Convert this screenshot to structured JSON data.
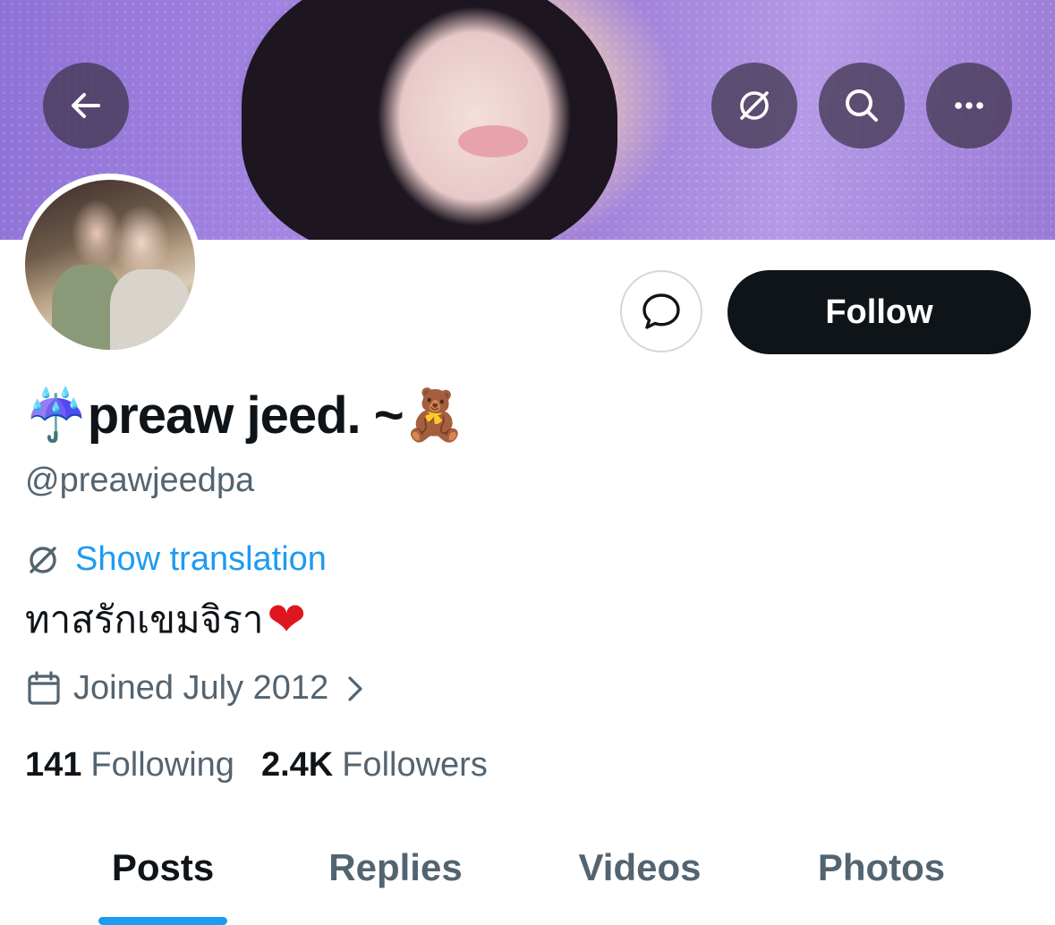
{
  "header": {
    "back_icon": "arrow-left-icon",
    "actions": [
      "translate-icon",
      "search-icon",
      "more-icon"
    ]
  },
  "profile": {
    "display_name": "preaw jeed. ~",
    "name_prefix_emoji": "☔",
    "name_suffix_emoji": "🧸",
    "handle": "@preawjeedpa",
    "show_translation_label": "Show translation",
    "bio": "ทาสรักเขมจิรา",
    "bio_emoji": "❤",
    "joined": "Joined July 2012",
    "following_count": "141",
    "following_label": "Following",
    "followers_count": "2.4K",
    "followers_label": "Followers"
  },
  "actions": {
    "follow_label": "Follow"
  },
  "tabs": [
    {
      "label": "Posts",
      "active": true
    },
    {
      "label": "Replies",
      "active": false
    },
    {
      "label": "Videos",
      "active": false
    },
    {
      "label": "Photos",
      "active": false
    }
  ],
  "colors": {
    "accent": "#1d9bf0",
    "text_primary": "#0f1419",
    "text_secondary": "#536471",
    "follow_bg": "#0f1419"
  }
}
